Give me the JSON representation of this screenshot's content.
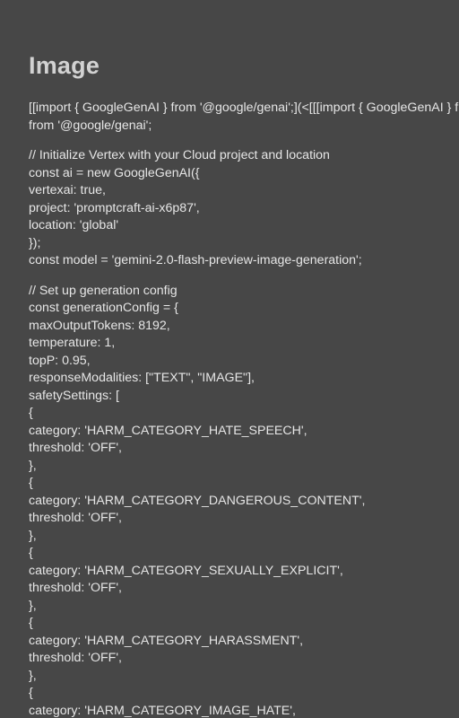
{
  "heading": "Image",
  "blocks": [
    [
      "[[import { GoogleGenAI } from '@google/genai';](<[[[import { GoogleGenAI } from '@google/genai';](<",
      "from '@google/genai';"
    ],
    [
      "// Initialize Vertex with your Cloud project and location",
      "const ai = new GoogleGenAI({",
      "vertexai: true,",
      "project: 'promptcraft-ai-x6p87',",
      "location: 'global'",
      "});",
      "const model = 'gemini-2.0-flash-preview-image-generation';"
    ],
    [
      "// Set up generation config",
      "const generationConfig = {",
      "maxOutputTokens: 8192,",
      "temperature: 1,",
      "topP: 0.95,",
      "responseModalities: [\"TEXT\", \"IMAGE\"],",
      "safetySettings: [",
      "{",
      "category: 'HARM_CATEGORY_HATE_SPEECH',",
      "threshold: 'OFF',",
      "},",
      "{",
      "category: 'HARM_CATEGORY_DANGEROUS_CONTENT',",
      "threshold: 'OFF',",
      "},",
      "{",
      "category: 'HARM_CATEGORY_SEXUALLY_EXPLICIT',",
      "threshold: 'OFF',",
      "},",
      "{",
      "category: 'HARM_CATEGORY_HARASSMENT',",
      "threshold: 'OFF',",
      "},",
      "{",
      "category: 'HARM_CATEGORY_IMAGE_HATE',"
    ]
  ]
}
